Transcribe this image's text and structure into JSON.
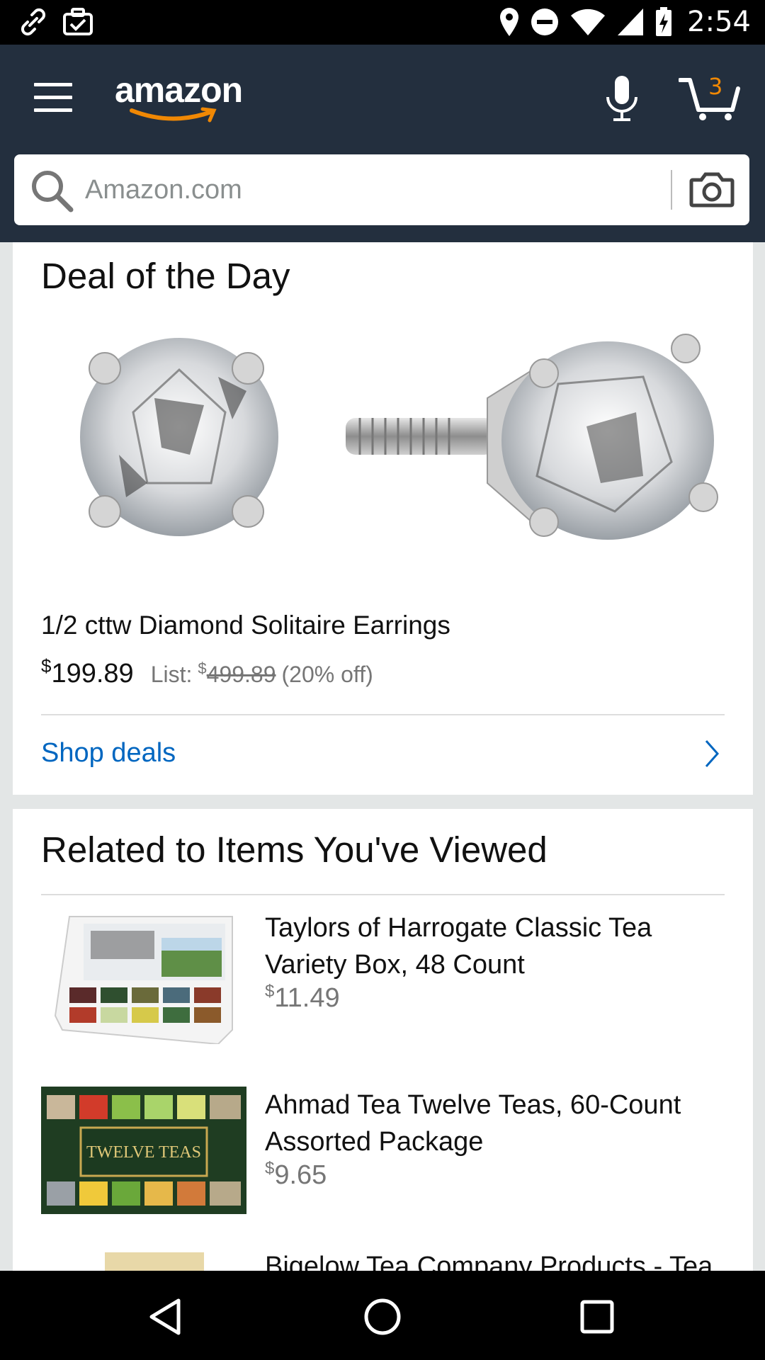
{
  "status_bar": {
    "time": "2:54",
    "left_icons": [
      "link-icon",
      "briefcase-check-icon"
    ],
    "right_icons": [
      "location-icon",
      "do-not-disturb-icon",
      "wifi-icon",
      "signal-icon",
      "battery-charging-icon"
    ]
  },
  "header": {
    "logo_text": "amazon",
    "cart_count": "3",
    "search_placeholder": "Amazon.com",
    "brand_color": "#232f3e",
    "accent_color": "#f08804"
  },
  "deal": {
    "title": "Deal of the Day",
    "product_name": "1/2 cttw Diamond Solitaire Earrings",
    "currency": "$",
    "price": "199.89",
    "list_label": "List:",
    "list_currency": "$",
    "list_price": "499.89",
    "savings": "(20% off)",
    "shop_link": "Shop deals"
  },
  "related": {
    "title": "Related to Items You've Viewed",
    "items": [
      {
        "title": "Taylors of Harrogate Classic Tea Variety Box, 48 Count",
        "currency": "$",
        "price": "11.49"
      },
      {
        "title": "Ahmad Tea Twelve Teas, 60-Count Assorted Package",
        "currency": "$",
        "price": "9.65",
        "image_text": "TWELVE TEAS"
      },
      {
        "title": "Bigelow Tea Company Products - Tea"
      }
    ]
  },
  "nav": {
    "buttons": [
      "back-icon",
      "home-icon",
      "recents-icon"
    ]
  }
}
